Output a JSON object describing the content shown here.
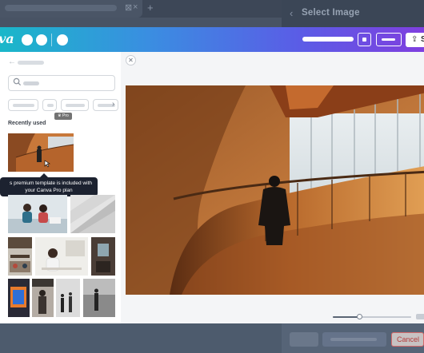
{
  "background_dialog": {
    "title": "Select Image",
    "back_icon": "chevron-left-icon",
    "cancel_label": "Cancel"
  },
  "toolbar": {
    "logo_text": "va",
    "share_label": "S",
    "share_icon": "upload-icon"
  },
  "left_panel": {
    "section_title": "Recently used",
    "pro_badge": "♛ Pro",
    "tooltip": {
      "line1": "s premium template is included with",
      "line2": "your Canva Pro plan"
    }
  },
  "colors": {
    "toolbar_gradient_start": "#1ab7c9",
    "toolbar_gradient_end": "#7f3fdf",
    "tooltip_bg": "#1c2230",
    "panel_bg": "#ffffff",
    "overlay_bg": "#4d5b6d"
  },
  "preview": {
    "close_icon": "close-icon",
    "zoom_level_fraction": 0.33
  }
}
